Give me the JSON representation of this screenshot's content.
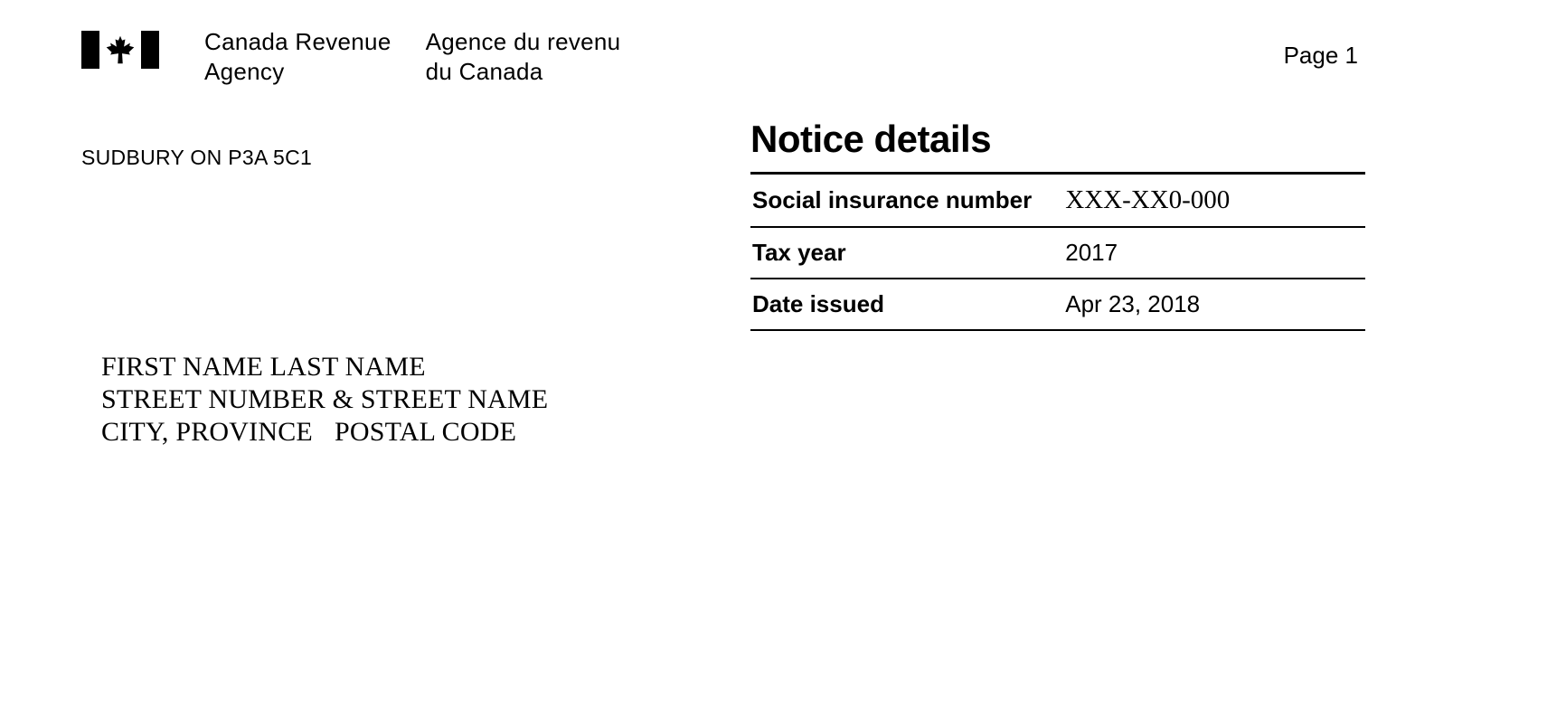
{
  "header": {
    "agency_en": "Canada Revenue\nAgency",
    "agency_fr": "Agence du revenu\ndu Canada",
    "page_label": "Page 1"
  },
  "sender": {
    "address": "SUDBURY ON P3A 5C1"
  },
  "recipient": {
    "name": "FIRST NAME LAST NAME",
    "street": "STREET NUMBER & STREET NAME",
    "city_province": "CITY, PROVINCE",
    "postal_code": "POSTAL CODE"
  },
  "notice": {
    "title": "Notice details",
    "rows": [
      {
        "label": "Social insurance number",
        "value": "XXX-XX0-000",
        "serif": true
      },
      {
        "label": "Tax year",
        "value": "2017",
        "serif": false
      },
      {
        "label": "Date issued",
        "value": "Apr 23, 2018",
        "serif": false
      }
    ]
  }
}
